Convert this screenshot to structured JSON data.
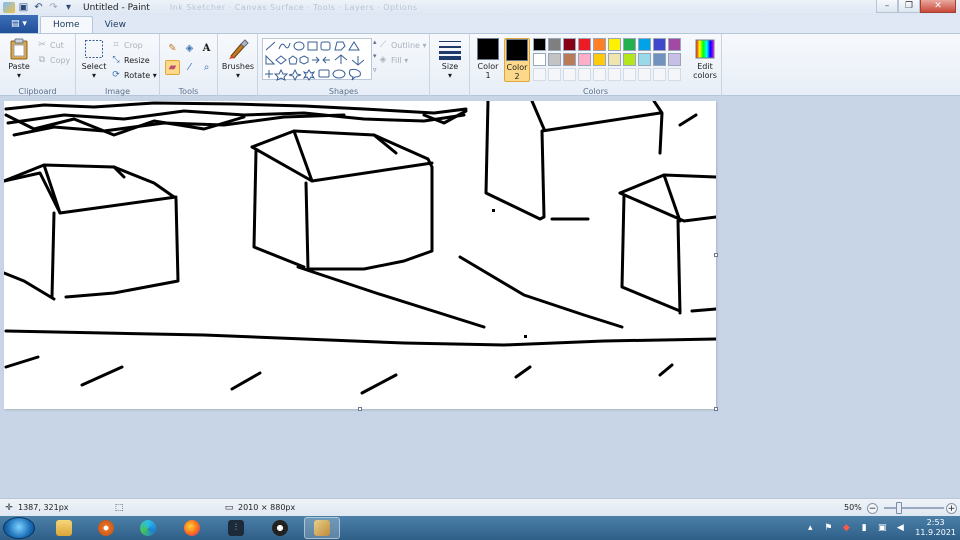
{
  "window": {
    "title": "Untitled - Paint",
    "ghost_title": "Ink Sketcher · Canvas Surface · Tools · Layers · Options",
    "minimize": "–",
    "maximize": "❐",
    "close": "✕"
  },
  "tabs": {
    "file_glyph": "▤ ▾",
    "home": "Home",
    "view": "View"
  },
  "ribbon": {
    "clipboard": {
      "label": "Clipboard",
      "paste": "Paste",
      "cut": "Cut",
      "copy": "Copy"
    },
    "image": {
      "label": "Image",
      "select": "Select",
      "crop": "Crop",
      "resize": "Resize",
      "rotate": "Rotate"
    },
    "tools": {
      "label": "Tools"
    },
    "brushes": {
      "label": "Brushes"
    },
    "shapes": {
      "label": "Shapes",
      "outline": "Outline",
      "fill": "Fill"
    },
    "size": {
      "label": "Size"
    },
    "colors": {
      "label": "Colors",
      "color1": "Color\n1",
      "color2": "Color\n2",
      "color1_value": "#000000",
      "color2_value": "#000000",
      "edit": "Edit\ncolors",
      "palette": [
        "#000000",
        "#7f7f7f",
        "#880015",
        "#ed1c24",
        "#ff7f27",
        "#fff200",
        "#22b14c",
        "#00a2e8",
        "#3f48cc",
        "#a349a4",
        "#ffffff",
        "#c3c3c3",
        "#b97a57",
        "#ffaec9",
        "#ffc90e",
        "#efe4b0",
        "#b5e61d",
        "#99d9ea",
        "#7092be",
        "#c8bfe7"
      ]
    }
  },
  "status": {
    "cursor_pos": "1387, 321px",
    "image_size": "2010 × 880px",
    "zoom": "50%"
  },
  "taskbar": {
    "time": "2:53",
    "date": "11.9.2021"
  }
}
